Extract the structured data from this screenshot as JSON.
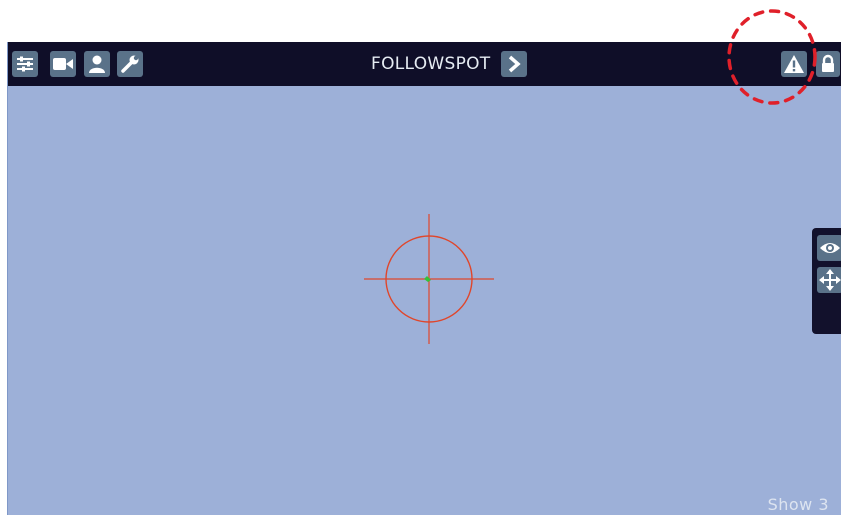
{
  "toolbar": {
    "left_buttons": [
      {
        "name": "sliders-icon",
        "label": "Settings"
      },
      {
        "name": "video-camera-icon",
        "label": "Camera"
      },
      {
        "name": "user-icon",
        "label": "User"
      },
      {
        "name": "wrench-icon",
        "label": "Tools"
      }
    ],
    "mode_label": "FOLLOWSPOT",
    "next_icon": "chevron-right-icon",
    "right_buttons": [
      {
        "name": "warning-icon"
      },
      {
        "name": "lock-icon"
      }
    ],
    "background": "#0f0e28",
    "button_color": "#5a7289"
  },
  "side_panel": {
    "buttons": [
      {
        "name": "eye-icon"
      },
      {
        "name": "move-arrows-icon"
      }
    ]
  },
  "viewport": {
    "background": "#9db0d8",
    "crosshair_color": "#e0462b",
    "target_marker_color": "#33c23a",
    "show_label": "Show 3"
  },
  "annotation": {
    "shape": "dashed-circle",
    "color": "#e0202a"
  }
}
